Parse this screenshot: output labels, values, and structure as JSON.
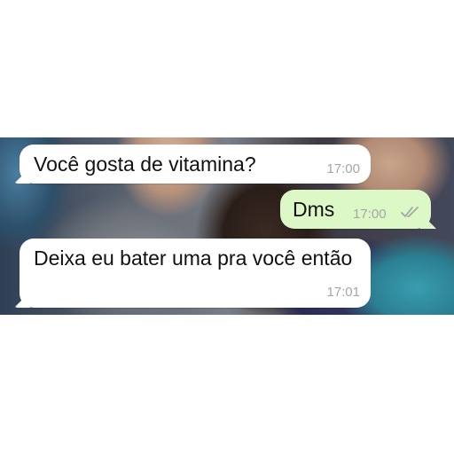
{
  "messages": [
    {
      "direction": "incoming",
      "text": "Você gosta de vitamina?",
      "time": "17:00"
    },
    {
      "direction": "outgoing",
      "text": "Dms",
      "time": "17:00",
      "status_icon": "double-check-icon"
    },
    {
      "direction": "incoming",
      "text": "Deixa eu bater uma pra você então",
      "time": "17:01"
    }
  ],
  "colors": {
    "incoming_bubble": "#ffffff",
    "outgoing_bubble": "#dcf8c6",
    "timestamp": "#a6a6a6",
    "page_background": "#ffffff"
  }
}
